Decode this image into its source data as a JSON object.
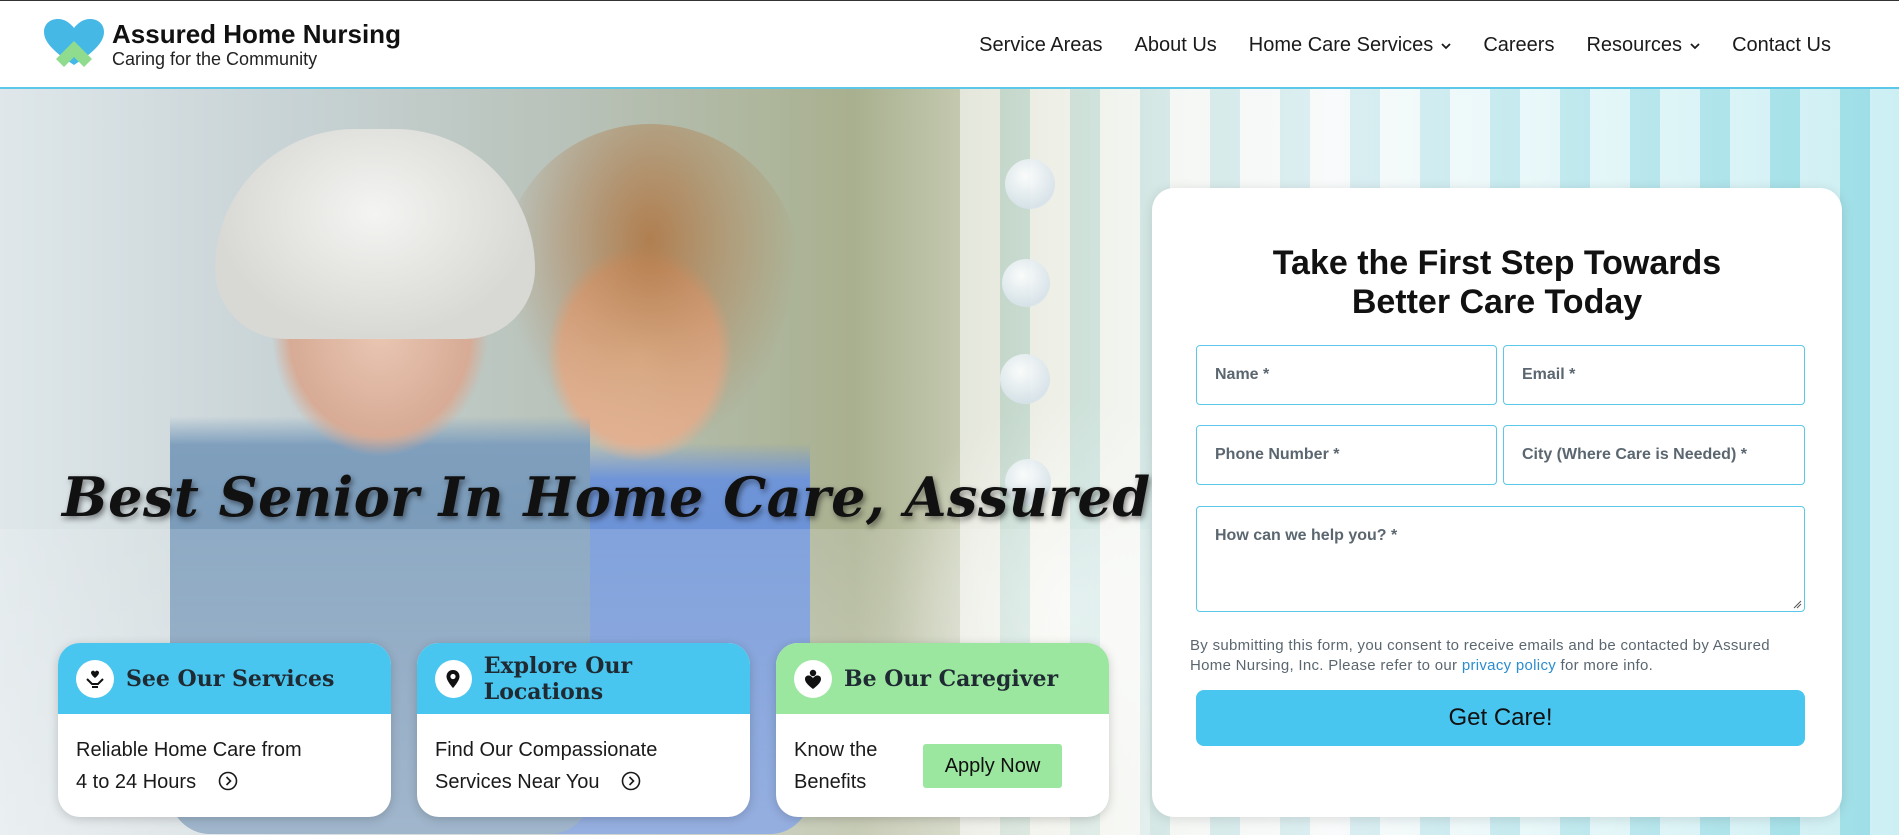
{
  "brand": {
    "title": "Assured Home Nursing",
    "subtitle": "Caring for the Community"
  },
  "nav": {
    "items": [
      {
        "label": "Service Areas",
        "has_dropdown": false
      },
      {
        "label": "About Us",
        "has_dropdown": false
      },
      {
        "label": "Home Care Services",
        "has_dropdown": true
      },
      {
        "label": "Careers",
        "has_dropdown": false
      },
      {
        "label": "Resources",
        "has_dropdown": true
      },
      {
        "label": "Contact Us",
        "has_dropdown": false
      }
    ]
  },
  "hero": {
    "headline": "Best Senior In Home Care, Assured!"
  },
  "cards": {
    "services": {
      "title": "See Our Services",
      "line1": "Reliable Home Care from",
      "line2": "4 to 24 Hours",
      "icon": "hands-heart-icon"
    },
    "locations": {
      "title": "Explore Our Locations",
      "line1": "Find Our Compassionate",
      "line2": "Services Near You",
      "icon": "map-pin-icon"
    },
    "caregiver": {
      "title": "Be Our Caregiver",
      "line1": "Know the",
      "line2": "Benefits",
      "button": "Apply Now",
      "icon": "person-heart-icon"
    }
  },
  "form": {
    "title_line1": "Take the First Step Towards",
    "title_line2": "Better Care Today",
    "fields": {
      "name": {
        "placeholder": "Name *",
        "value": ""
      },
      "email": {
        "placeholder": "Email *",
        "value": ""
      },
      "phone": {
        "placeholder": "Phone Number *",
        "value": ""
      },
      "city": {
        "placeholder": "City (Where Care is Needed) *",
        "value": ""
      },
      "message": {
        "placeholder": "How can we help you? *",
        "value": ""
      }
    },
    "consent_before": "By submitting this form, you consent to receive emails and be contacted by Assured Home Nursing, Inc. Please refer to our ",
    "consent_link": "privacy policy",
    "consent_after": " for more info.",
    "submit": "Get Care!"
  },
  "colors": {
    "accent_blue": "#49c6ef",
    "accent_green": "#9be79f",
    "logo_heart_blue": "#45b8e6",
    "logo_house_green": "#8fdc8f",
    "link_blue": "#2b8ccf"
  }
}
